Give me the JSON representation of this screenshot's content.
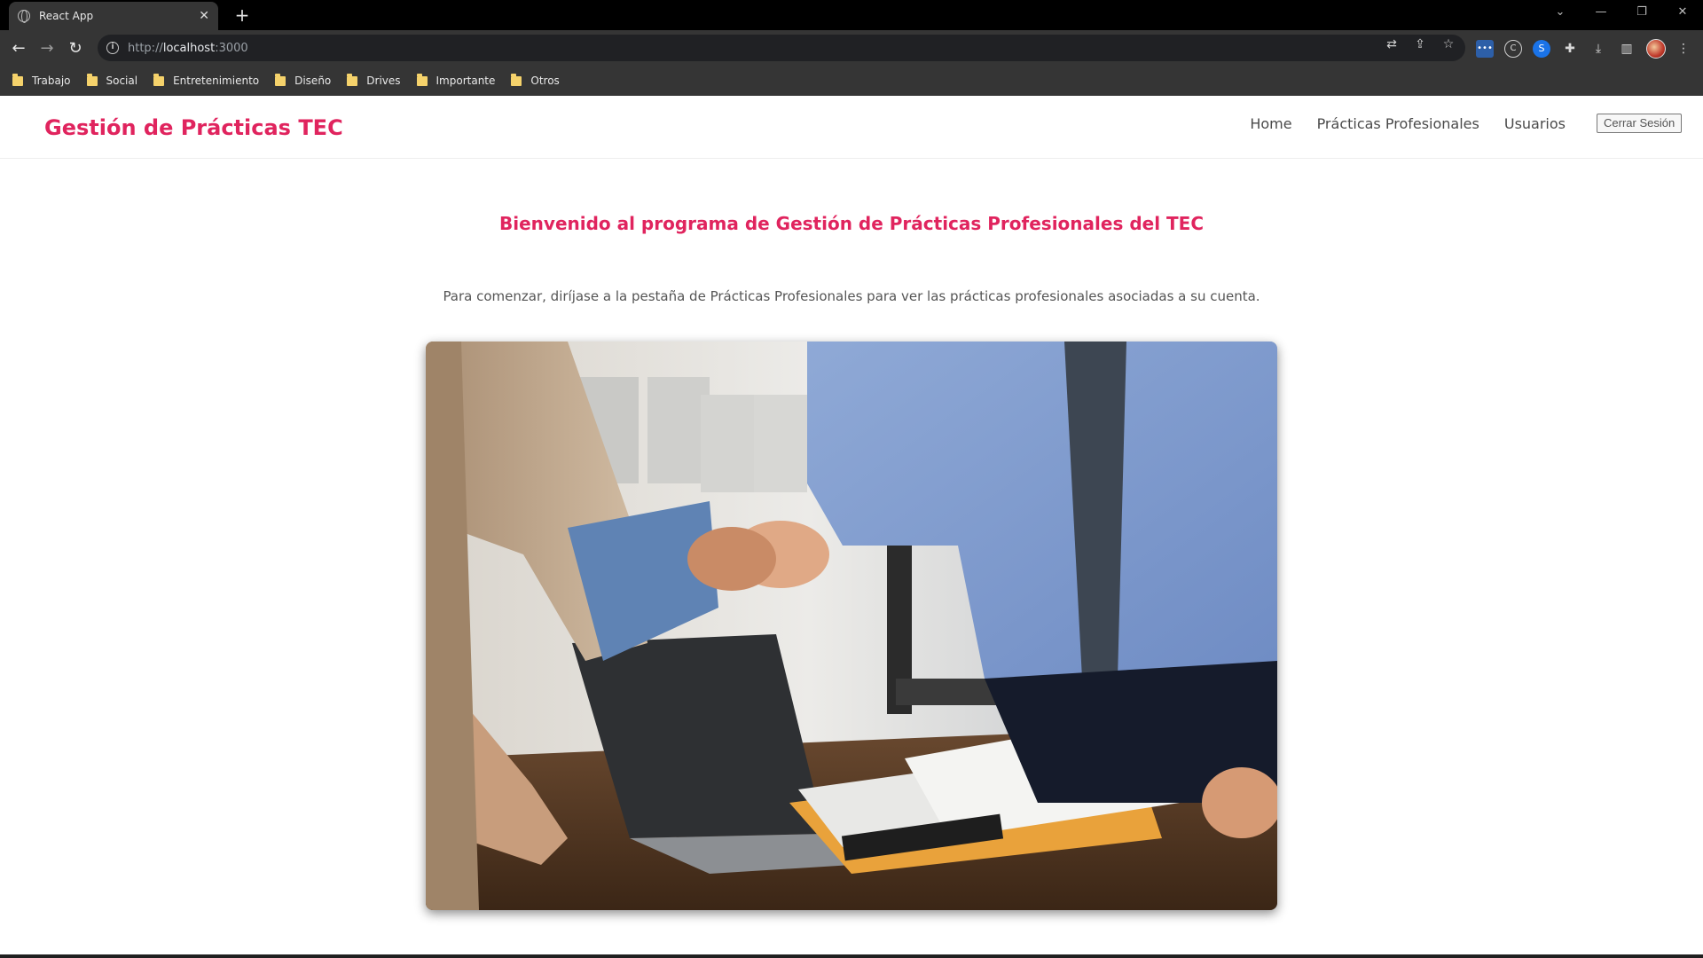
{
  "browser": {
    "tab_title": "React App",
    "tab_close": "✕",
    "new_tab": "+",
    "url_prefix": "http://",
    "url_host": "localhost",
    "url_suffix": ":3000",
    "bookmarks": [
      "Trabajo",
      "Social",
      "Entretenimiento",
      "Diseño",
      "Drives",
      "Importante",
      "Otros"
    ]
  },
  "app": {
    "brand": "Gestión de Prácticas TEC",
    "nav": {
      "home": "Home",
      "practicas": "Prácticas Profesionales",
      "usuarios": "Usuarios"
    },
    "logout_label": "Cerrar Sesión",
    "welcome": "Bienvenido al programa de Gestión de Prácticas Profesionales del TEC",
    "instructions": "Para comenzar, diríjase a la pestaña de Prácticas Profesionales para ver las prácticas profesionales asociadas a su cuenta."
  },
  "colors": {
    "accent": "#e0245e",
    "chrome_dark": "#000000",
    "chrome_toolbar": "#353535"
  },
  "icons": [
    "globe-icon",
    "back-arrow-icon",
    "forward-arrow-icon",
    "reload-icon",
    "info-icon",
    "translate-icon",
    "share-icon",
    "star-icon",
    "extensions-icon",
    "download-icon",
    "sidepanel-icon",
    "menu-icon",
    "folder-icon"
  ]
}
